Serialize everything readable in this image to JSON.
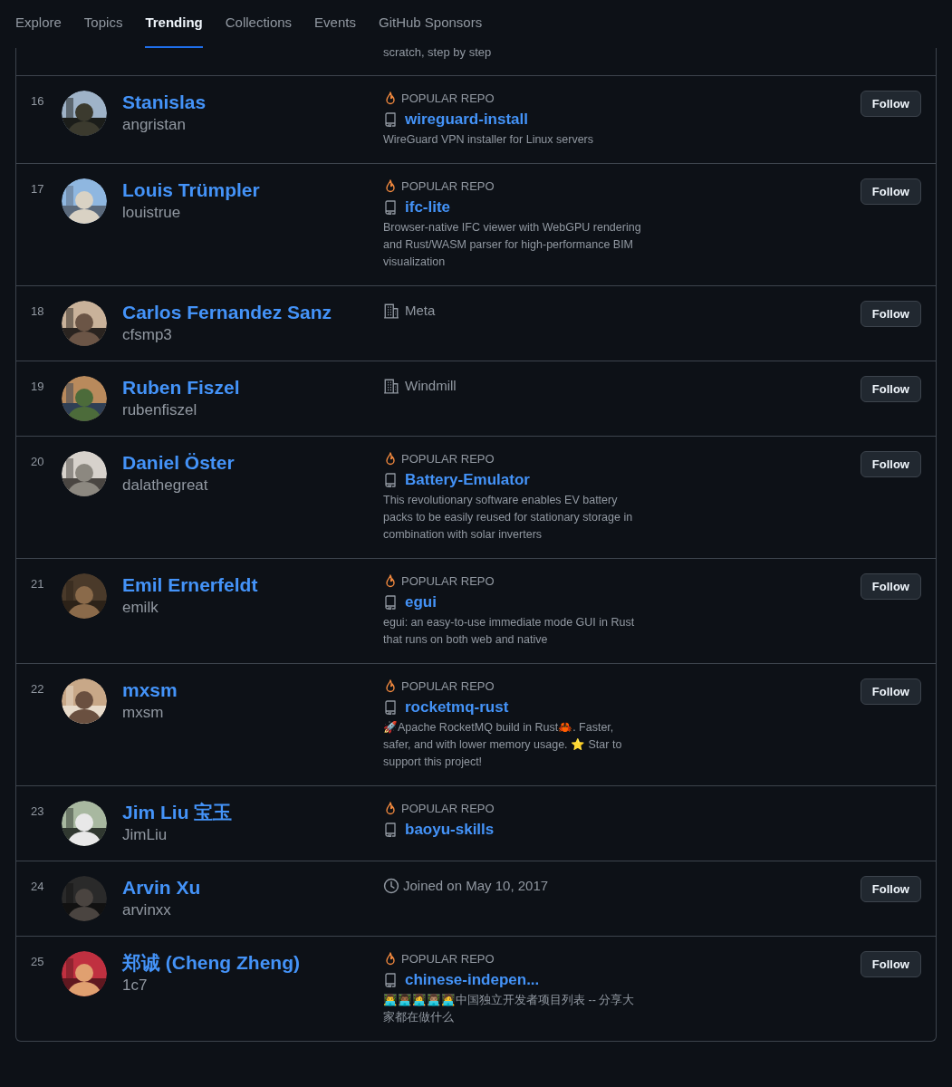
{
  "nav": [
    {
      "label": "Explore",
      "selected": false
    },
    {
      "label": "Topics",
      "selected": false
    },
    {
      "label": "Trending",
      "selected": true
    },
    {
      "label": "Collections",
      "selected": false
    },
    {
      "label": "Events",
      "selected": false
    },
    {
      "label": "GitHub Sponsors",
      "selected": false
    }
  ],
  "partial_row": {
    "description": "scratch, step by step"
  },
  "developers": [
    {
      "rank": "16",
      "name": "Stanislas",
      "username": "angristan",
      "kind": "popular_repo",
      "badge": "POPULAR REPO",
      "repo": "wireguard-install",
      "description": "WireGuard VPN installer for Linux servers",
      "button": "Follow"
    },
    {
      "rank": "17",
      "name": "Louis Trümpler",
      "username": "louistrue",
      "kind": "popular_repo",
      "badge": "POPULAR REPO",
      "repo": "ifc-lite",
      "description": "Browser-native IFC viewer with WebGPU rendering and Rust/WASM parser for high-performance BIM visualization",
      "button": "Follow"
    },
    {
      "rank": "18",
      "name": "Carlos Fernandez Sanz",
      "username": "cfsmp3",
      "kind": "organization",
      "text": "Meta",
      "button": "Follow"
    },
    {
      "rank": "19",
      "name": "Ruben Fiszel",
      "username": "rubenfiszel",
      "kind": "organization",
      "text": "Windmill",
      "button": "Follow"
    },
    {
      "rank": "20",
      "name": "Daniel Öster",
      "username": "dalathegreat",
      "kind": "popular_repo",
      "badge": "POPULAR REPO",
      "repo": "Battery-Emulator",
      "description": "This revolutionary software enables EV battery packs to be easily reused for stationary storage in combination with solar inverters",
      "button": "Follow"
    },
    {
      "rank": "21",
      "name": "Emil Ernerfeldt",
      "username": "emilk",
      "kind": "popular_repo",
      "badge": "POPULAR REPO",
      "repo": "egui",
      "description": "egui: an easy-to-use immediate mode GUI in Rust that runs on both web and native",
      "button": "Follow"
    },
    {
      "rank": "22",
      "name": "mxsm",
      "username": "mxsm",
      "kind": "popular_repo",
      "badge": "POPULAR REPO",
      "repo": "rocketmq-rust",
      "description": "🚀Apache RocketMQ build in Rust🦀. Faster, safer, and with lower memory usage. ⭐ Star to support this project!",
      "button": "Follow"
    },
    {
      "rank": "23",
      "name": "Jim Liu 宝玉",
      "username": "JimLiu",
      "kind": "popular_repo",
      "badge": "POPULAR REPO",
      "repo": "baoyu-skills"
    },
    {
      "rank": "24",
      "name": "Arvin Xu",
      "username": "arvinxx",
      "kind": "joined",
      "text": "Joined on May 10, 2017",
      "button": "Follow"
    },
    {
      "rank": "25",
      "name": "郑诚 (Cheng Zheng)",
      "username": "1c7",
      "kind": "popular_repo",
      "badge": "POPULAR REPO",
      "repo": "chinese-indepen...",
      "description": "👨‍💻👨🏾‍💻👩‍💻👨🏽‍💻🧑‍💻中国独立开发者项目列表 -- 分享大家都在做什么",
      "button": "Follow"
    }
  ]
}
